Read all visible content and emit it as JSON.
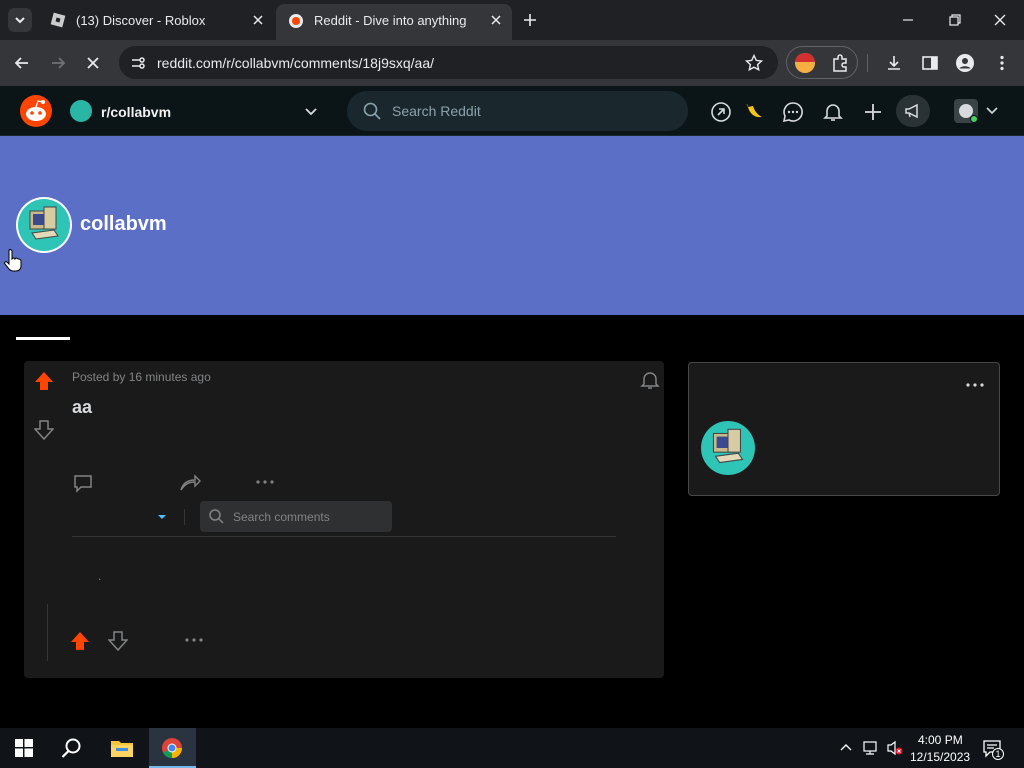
{
  "browser": {
    "tabs": [
      {
        "title": "(13) Discover - Roblox",
        "active": false
      },
      {
        "title": "Reddit - Dive into anything",
        "active": true
      }
    ],
    "url": "reddit.com/r/collabvm/comments/18j9sxq/aa/"
  },
  "reddit_header": {
    "community": "r/collabvm",
    "search_placeholder": "Search Reddit"
  },
  "banner": {
    "subreddit_name": "collabvm",
    "color": "#5c6fc6"
  },
  "post": {
    "posted_by": "Posted by 16 minutes ago",
    "title": "aa",
    "comment_search_placeholder": "Search comments",
    "comment_body": "."
  },
  "taskbar": {
    "time": "4:00 PM",
    "date": "12/15/2023",
    "notification_count": "1"
  },
  "colors": {
    "upvote": "#ff4500",
    "reddit_bg": "#0b1416",
    "card_bg": "#1a1a1b"
  }
}
